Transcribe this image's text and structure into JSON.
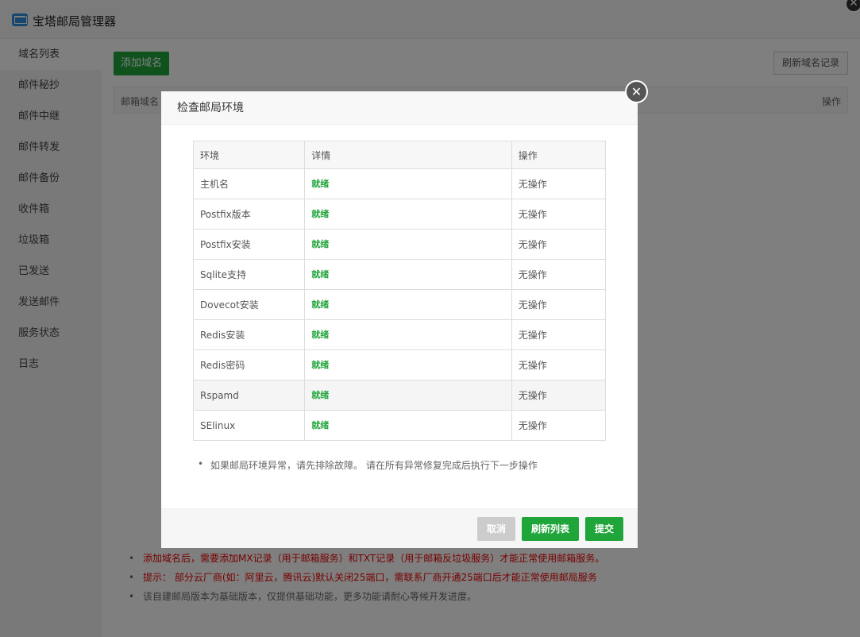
{
  "app": {
    "title": "宝塔邮局管理器",
    "close_glyph": "✕"
  },
  "sidebar": {
    "items": [
      {
        "label": "域名列表"
      },
      {
        "label": "邮件秘抄"
      },
      {
        "label": "邮件中继"
      },
      {
        "label": "邮件转发"
      },
      {
        "label": "邮件备份"
      },
      {
        "label": "收件箱"
      },
      {
        "label": "垃圾箱"
      },
      {
        "label": "已发送"
      },
      {
        "label": "发送邮件"
      },
      {
        "label": "服务状态"
      },
      {
        "label": "日志"
      }
    ]
  },
  "main": {
    "add_domain_label": "添加域名",
    "refresh_domain_label": "刷新域名记录",
    "table": {
      "col_domain": "邮箱域名",
      "col_op": "操作"
    },
    "notes": [
      "添加域名后，需要添加MX记录（用于邮箱服务）和TXT记录（用于邮箱反垃圾服务）才能正常使用邮箱服务。",
      "提示： 部分云厂商(如：阿里云，腾讯云)默认关闭25端口，需联系厂商开通25端口后才能正常使用邮局服务",
      "该自建邮局版本为基础版本，仅提供基础功能，更多功能请耐心等候开发进度。"
    ]
  },
  "modal": {
    "title": "检查邮局环境",
    "close_glyph": "✕",
    "columns": {
      "env": "环境",
      "detail": "详情",
      "op": "操作"
    },
    "rows": [
      {
        "env": "主机名",
        "detail": "就绪",
        "op": "无操作"
      },
      {
        "env": "Postfix版本",
        "detail": "就绪",
        "op": "无操作"
      },
      {
        "env": "Postfix安装",
        "detail": "就绪",
        "op": "无操作"
      },
      {
        "env": "Sqlite支持",
        "detail": "就绪",
        "op": "无操作"
      },
      {
        "env": "Dovecot安装",
        "detail": "就绪",
        "op": "无操作"
      },
      {
        "env": "Redis安装",
        "detail": "就绪",
        "op": "无操作"
      },
      {
        "env": "Redis密码",
        "detail": "就绪",
        "op": "无操作"
      },
      {
        "env": "Rspamd",
        "detail": "就绪",
        "op": "无操作"
      },
      {
        "env": "SElinux",
        "detail": "就绪",
        "op": "无操作"
      }
    ],
    "tip": "如果邮局环境异常，请先排除故障。 请在所有异常修复完成后执行下一步操作",
    "buttons": {
      "cancel": "取消",
      "refresh": "刷新列表",
      "submit": "提交"
    }
  },
  "colors": {
    "accent": "#20a53a",
    "warning": "#ee0000"
  }
}
